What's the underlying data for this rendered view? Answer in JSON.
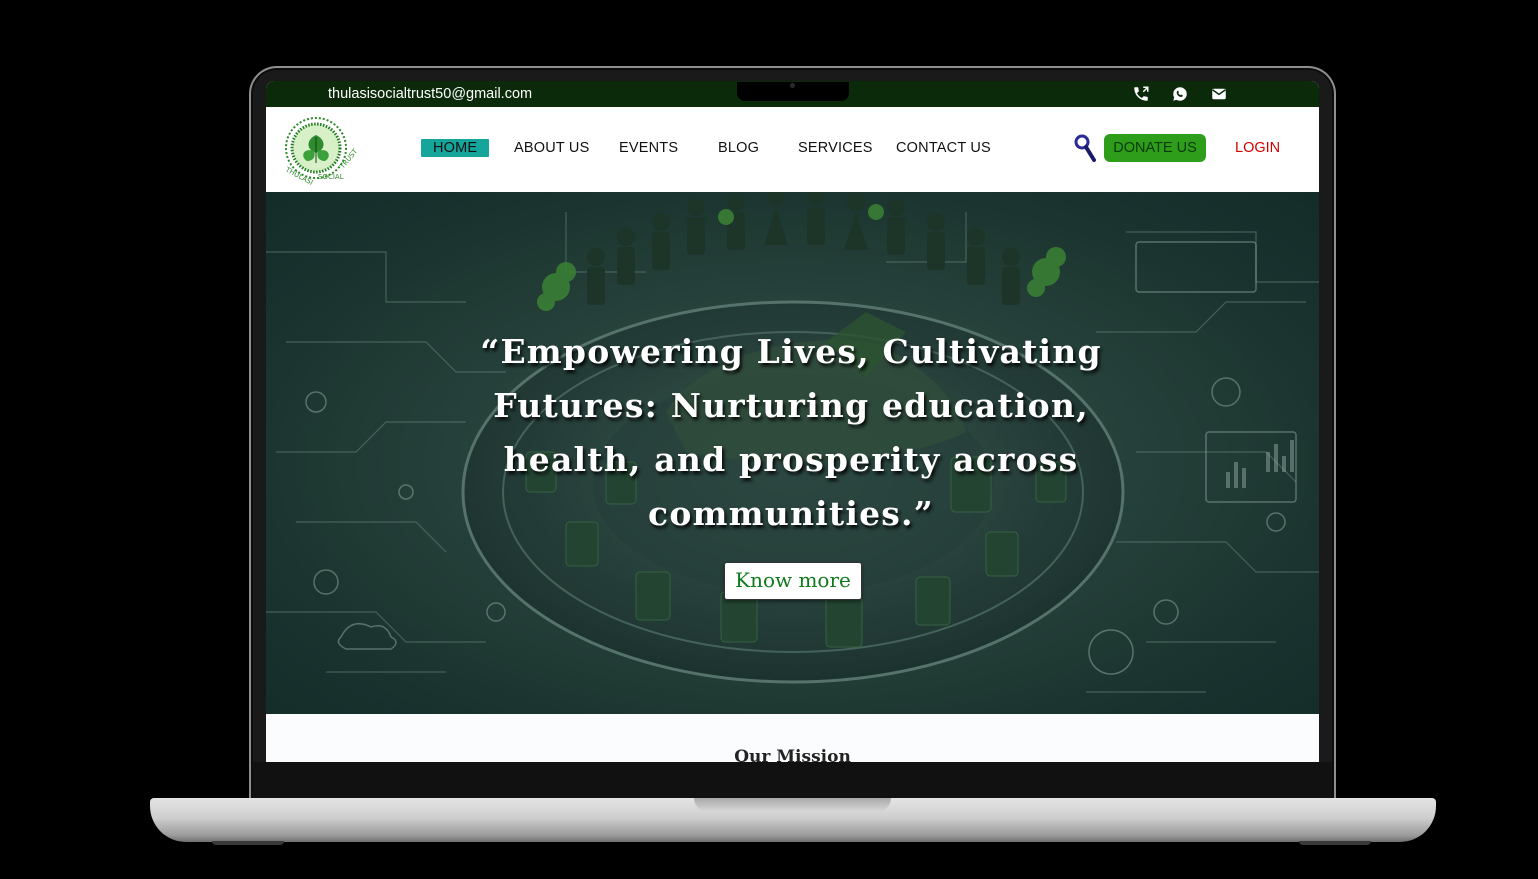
{
  "topbar": {
    "email": "thulasisocialtrust50@gmail.com",
    "icons": [
      "phone-icon",
      "whatsapp-icon",
      "mail-icon"
    ]
  },
  "brand": {
    "logo_text": "THULASI SOCIAL TRUST"
  },
  "nav": {
    "items": [
      {
        "label": "HOME",
        "active": true
      },
      {
        "label": "ABOUT US"
      },
      {
        "label": "EVENTS"
      },
      {
        "label": "BLOG"
      },
      {
        "label": "SERVICES"
      },
      {
        "label": "CONTACT US"
      }
    ],
    "donate_label": "DONATE US",
    "login_label": "LOGIN"
  },
  "hero": {
    "quote": "“Empowering Lives, Cultivating Futures: Nurturing education, health, and prosperity across communities.”",
    "cta_label": "Know more"
  },
  "mission": {
    "heading": "Our Mission"
  },
  "colors": {
    "topbar_bg": "#0a2a0a",
    "active_nav": "#16a59a",
    "donate_bg": "#2e9d1a",
    "login_text": "#d40000",
    "cta_text": "#0f7a1c"
  }
}
